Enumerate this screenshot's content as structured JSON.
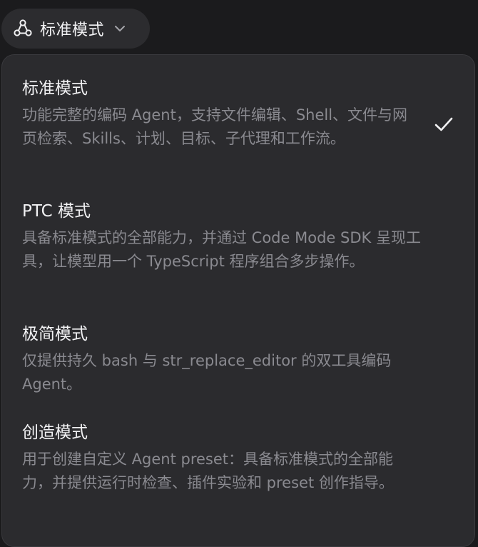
{
  "trigger": {
    "label": "标准模式"
  },
  "options": [
    {
      "title": "标准模式",
      "desc": "功能完整的编码 Agent，支持文件编辑、Shell、文件与网页检索、Skills、计划、目标、子代理和工作流。",
      "selected": true
    },
    {
      "title": "PTC 模式",
      "desc": "具备标准模式的全部能力，并通过 Code Mode SDK 呈现工具，让模型用一个 TypeScript 程序组合多步操作。",
      "selected": false
    },
    {
      "title": "极简模式",
      "desc": "仅提供持久 bash 与 str_replace_editor 的双工具编码 Agent。",
      "selected": false
    },
    {
      "title": "创造模式",
      "desc": "用于创建自定义 Agent preset：具备标准模式的全部能力，并提供运行时检查、插件实验和 preset 创作指导。",
      "selected": false
    }
  ],
  "colors": {
    "background": "#1a1a1c",
    "menu": "#2b2b2e",
    "title": "#f2f2f4",
    "description": "#8a8a90",
    "check": "#f2f2f4"
  },
  "icons": {
    "trigger": "share-nodes-icon",
    "dropdown": "chevron-down-icon",
    "selected": "check-icon"
  }
}
